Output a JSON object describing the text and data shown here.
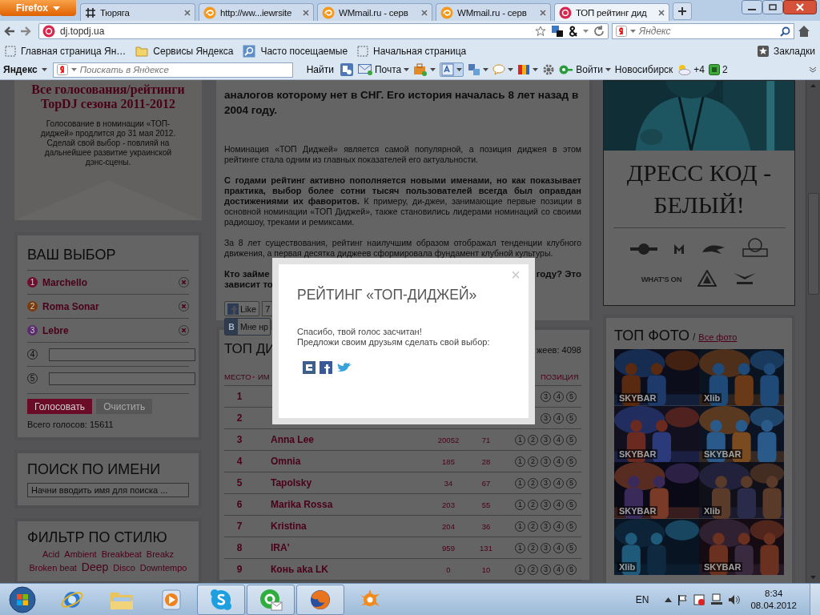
{
  "browser": {
    "menu_button": "Firefox",
    "tabs": [
      {
        "title": "Тюряга",
        "kind": "hash",
        "selected": false
      },
      {
        "title": "http://ww...iewrsite",
        "kind": "swirl",
        "selected": false
      },
      {
        "title": "WMmail.ru - серв",
        "kind": "swirl",
        "selected": false
      },
      {
        "title": "WMmail.ru - серв",
        "kind": "swirl",
        "selected": false
      },
      {
        "title": "ТОП рейтинг дид",
        "kind": "site",
        "selected": true
      }
    ],
    "address": "dj.topdj.ua",
    "search_placeholder": "Яндекс",
    "bookmarks": [
      {
        "label": "Главная страница Ян…",
        "kind": "page"
      },
      {
        "label": "Сервисы Яндекса",
        "kind": "folder"
      },
      {
        "label": "Часто посещаемые",
        "kind": "search"
      },
      {
        "label": "Начальная страница",
        "kind": "page"
      }
    ],
    "bookmarks_menu": "Закладки"
  },
  "yandex_bar": {
    "logo": "Яндекс",
    "search_placeholder": "Поискать в Яндексе",
    "find_button": "Найти",
    "mail": "Почта",
    "login": "Войти",
    "city": "Новосибирск",
    "weather": "+4",
    "counter": "2"
  },
  "left": {
    "intro_title": "Все голосования/рейтинги TopDJ сезона 2011-2012",
    "intro_text": "Голосование в номинации «ТОП-диджей» продлится до 31 мая 2012. Сделай свой выбор - повлияй на дальнейшее развитие украинской дэнс-сцены.",
    "vote": {
      "title": "ВАШ ВЫБОР",
      "items": [
        {
          "number": "1",
          "kind": "chosen",
          "name": "Marchello",
          "color": "#6e0d2e"
        },
        {
          "number": "2",
          "kind": "chosen",
          "name": "Roma Sonar",
          "color": "#7a3a0c"
        },
        {
          "number": "3",
          "kind": "chosen",
          "name": "Lebre",
          "color": "#5a2a6e"
        },
        {
          "number": "4",
          "kind": "empty"
        },
        {
          "number": "5",
          "kind": "empty"
        }
      ],
      "vote_button": "Голосовать",
      "clear_button": "Очистить",
      "total": "Всего голосов: 15611"
    },
    "search": {
      "title": "ПОИСК ПО ИМЕНИ",
      "placeholder": "Начни вводить имя для поиска ..."
    },
    "filter": {
      "title": "ФИЛЬТР ПО СТИЛЮ",
      "tags": [
        {
          "label": "Acid",
          "kind": "small"
        },
        {
          "label": "Ambient",
          "kind": "small"
        },
        {
          "label": "Breakbeat",
          "kind": "small"
        },
        {
          "label": "Breakz",
          "kind": "small"
        },
        {
          "label": "Broken beat",
          "kind": "small"
        },
        {
          "label": "Deep",
          "kind": "large"
        },
        {
          "label": "Disco",
          "kind": "small"
        },
        {
          "label": "Downtempo",
          "kind": "small"
        }
      ]
    }
  },
  "article": {
    "lead": "аналогов которому нет в СНГ. Его история началась 8 лет назад в 2004 году.",
    "paragraphs": [
      "Номинация «ТОП Диджей» является самой популярной, а позиция диджея в этом рейтинге стала одним из главных показателей его актуальности.",
      "**С годами рейтинг активно пополняется новыми именами, но как показывает практика, выбор более сотни тысяч пользователей всегда был оправдан достижениями их фаворитов.** К примеру, ди-джеи, занимающие первые позиции в основной номинации «ТОП Диджей», также становились лидерами номинаций со своими радиошоу, треками и ремиксами.",
      "За 8 лет существования, рейтинг наилучшим образом отображал тенденции клубного движения, а первая десятка диджеев сформировала фундамент клубной культуры."
    ],
    "question_left": [
      "Кто займе",
      "зависит то"
    ],
    "question_right": "году? Это",
    "like_button": "Like",
    "like_count": "7",
    "vk_letter": "В",
    "vk_button": "Мне нр"
  },
  "table": {
    "title": "ТОП ДИ",
    "count": "жеев: 4098",
    "columns": {
      "place": "МЕСТО",
      "name": "ИМ",
      "position": "ПОЗИЦИЯ"
    },
    "rows": [
      {
        "place": "1",
        "positions": [
          "3",
          "4",
          "5"
        ]
      },
      {
        "place": "2",
        "positions": [
          "3",
          "4",
          "5"
        ]
      },
      {
        "place": "3",
        "name": "Anna Lee",
        "column_3": "20052",
        "column_4": "71",
        "positions": [
          "1",
          "2",
          "3",
          "4",
          "5"
        ]
      },
      {
        "place": "4",
        "name": "Omnia",
        "column_3": "185",
        "column_4": "28",
        "positions": [
          "1",
          "2",
          "3",
          "4",
          "5"
        ]
      },
      {
        "place": "5",
        "name": "Tapolsky",
        "column_3": "34",
        "column_4": "67",
        "positions": [
          "1",
          "2",
          "3",
          "4",
          "5"
        ]
      },
      {
        "place": "6",
        "name": "Marika Rossa",
        "column_3": "203",
        "column_4": "55",
        "positions": [
          "1",
          "2",
          "3",
          "4",
          "5"
        ]
      },
      {
        "place": "7",
        "name": "Kristina",
        "column_3": "204",
        "column_4": "36",
        "positions": [
          "1",
          "2",
          "3",
          "4",
          "5"
        ]
      },
      {
        "place": "8",
        "name": "IRA'",
        "column_3": "959",
        "column_4": "131",
        "positions": [
          "1",
          "2",
          "3",
          "4",
          "5"
        ]
      },
      {
        "place": "9",
        "name": "Конь aka LK",
        "column_3": "0",
        "column_4": "10",
        "positions": [
          "1",
          "2",
          "3",
          "4",
          "5"
        ]
      }
    ]
  },
  "right": {
    "banner_title": "ДРЕСС КОД - БЕЛЫЙ!",
    "logo_text": "WHAT'S ON",
    "photos_title": "ТОП ФОТО",
    "photos_separator": "/",
    "photos_link": "Все фото",
    "photos": [
      {
        "caption": "SKYBAR"
      },
      {
        "caption": "Xlib"
      },
      {
        "caption": "SKYBAR"
      },
      {
        "caption": "SKYBAR"
      },
      {
        "caption": "SKYBAR"
      },
      {
        "caption": "Xlib"
      },
      {
        "caption": "Xlib"
      },
      {
        "caption": "SKYBAR"
      }
    ]
  },
  "modal": {
    "title": "РЕЙТИНГ «ТОП-ДИДЖЕЙ»",
    "lines": [
      "Спасибо, твой голос засчитан!",
      "Предложи своим друзьям сделать свой выбор:"
    ],
    "close": "×"
  },
  "taskbar": {
    "apps": [
      {
        "kind": "ie",
        "open": false
      },
      {
        "kind": "explorer",
        "open": false
      },
      {
        "kind": "media",
        "open": false
      },
      {
        "kind": "skype",
        "open": true
      },
      {
        "kind": "mail",
        "open": true
      },
      {
        "kind": "firefox",
        "open": true
      },
      {
        "kind": "avast",
        "open": false
      }
    ],
    "language": "EN",
    "time": "8:34",
    "date": "08.04.2012"
  }
}
